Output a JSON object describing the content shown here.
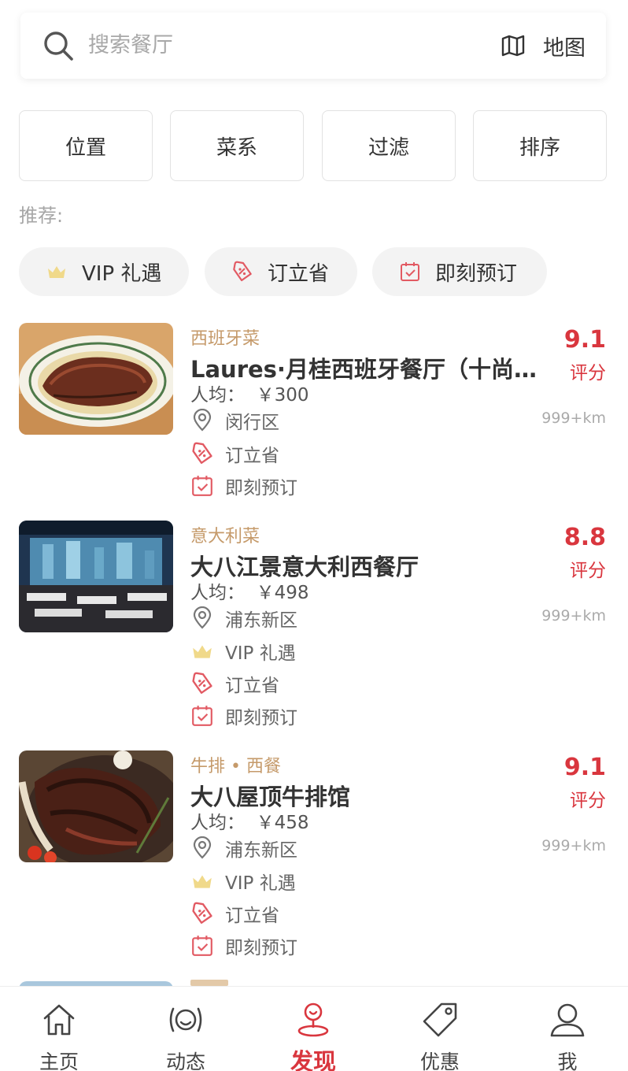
{
  "search": {
    "placeholder": "搜索餐厅",
    "map_label": "地图"
  },
  "filters": [
    "位置",
    "菜系",
    "过滤",
    "排序"
  ],
  "recommend_label": "推荐:",
  "chips": [
    {
      "label": "VIP 礼遇",
      "icon": "crown-icon"
    },
    {
      "label": "订立省",
      "icon": "discount-tag-icon"
    },
    {
      "label": "即刻预订",
      "icon": "calendar-check-icon"
    }
  ],
  "restaurants": [
    {
      "cuisine": "西班牙菜",
      "name": "Laures·月桂西班牙餐厅（十尚…",
      "price": "人均：  ￥300",
      "score": "9.1",
      "score_label": "评分",
      "district": "闵行区",
      "distance": "999+km",
      "features": [
        "订立省",
        "即刻预订"
      ]
    },
    {
      "cuisine": "意大利菜",
      "name": "大八江景意大利西餐厅",
      "price": "人均：  ￥498",
      "score": "8.8",
      "score_label": "评分",
      "district": "浦东新区",
      "distance": "999+km",
      "features": [
        "VIP 礼遇",
        "订立省",
        "即刻预订"
      ]
    },
    {
      "cuisine": "牛排 • 西餐",
      "name": "大八屋顶牛排馆",
      "price": "人均：  ￥458",
      "score": "9.1",
      "score_label": "评分",
      "district": "浦东新区",
      "distance": "999+km",
      "features": [
        "VIP 礼遇",
        "订立省",
        "即刻预订"
      ]
    }
  ],
  "tabbar": [
    {
      "label": "主页",
      "icon": "home-icon",
      "active": false
    },
    {
      "label": "动态",
      "icon": "moments-icon",
      "active": false
    },
    {
      "label": "发现",
      "icon": "discover-icon",
      "active": true
    },
    {
      "label": "优惠",
      "icon": "coupon-tag-icon",
      "active": false
    },
    {
      "label": "我",
      "icon": "profile-icon",
      "active": false
    }
  ],
  "colors": {
    "accent": "#d9363e",
    "cuisine": "#c59a6a",
    "crown": "#f0d98a"
  }
}
